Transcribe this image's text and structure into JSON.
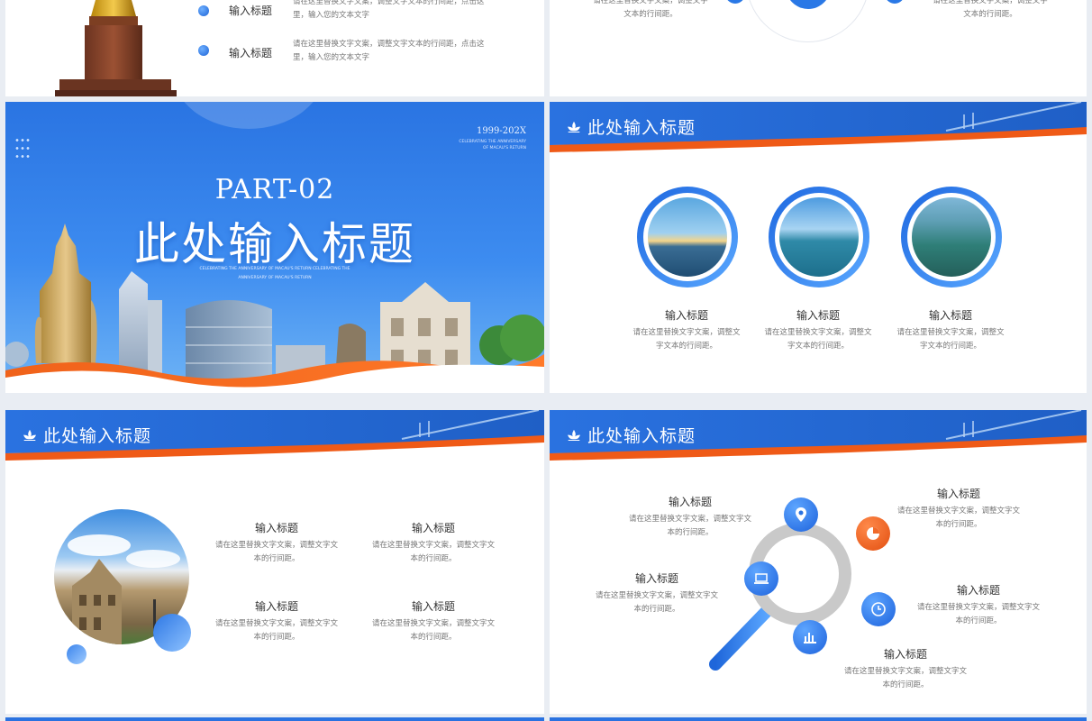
{
  "slide1": {
    "items": [
      {
        "title": "输入标题",
        "text": "请在这里替换文字文案，调整文字文本的行间距，点击这里，输入您的文本文字"
      },
      {
        "title": "输入标题",
        "text": "请在这里替换文字文案，调整文字文本的行间距，点击这里，输入您的文本文字"
      }
    ]
  },
  "slide2": {
    "texts": [
      {
        "text": "请在这里替换文字文案，调整文字文本的行间距。"
      },
      {
        "text": "请在这里替换文字文案，调整文字文本的行间距。"
      }
    ]
  },
  "cover": {
    "years": "1999-202X",
    "years_sub1": "CELEBRATING THE ANNIVERSARY",
    "years_sub2": "OF MACAU'S RETURN",
    "part": "PART-02",
    "title": "此处输入标题",
    "sub1": "CELEBRATING THE ANNIVERSARY OF MACAU'S RETURN CELEBRATING THE",
    "sub2": "ANNIVERSARY OF MACAU'S RETURN"
  },
  "header_title": "此处输入标题",
  "slide4": {
    "items": [
      {
        "title": "输入标题",
        "text": "请在这里替换文字文案，调整文字文本的行间距。"
      },
      {
        "title": "输入标题",
        "text": "请在这里替换文字文案，调整文字文本的行间距。"
      },
      {
        "title": "输入标题",
        "text": "请在这里替换文字文案，调整文字文本的行间距。"
      }
    ]
  },
  "slide5": {
    "items": [
      {
        "title": "输入标题",
        "text": "请在这里替换文字文案，调整文字文本的行间距。"
      },
      {
        "title": "输入标题",
        "text": "请在这里替换文字文案，调整文字文本的行间距。"
      },
      {
        "title": "输入标题",
        "text": "请在这里替换文字文案，调整文字文本的行间距。"
      },
      {
        "title": "输入标题",
        "text": "请在这里替换文字文案，调整文字文本的行间距。"
      }
    ]
  },
  "slide6": {
    "items": [
      {
        "title": "输入标题",
        "text": "请在这里替换文字文案，调整文字文本的行间距。"
      },
      {
        "title": "输入标题",
        "text": "请在这里替换文字文案，调整文字文本的行间距。"
      },
      {
        "title": "输入标题",
        "text": "请在这里替换文字文案，调整文字文本的行间距。"
      },
      {
        "title": "输入标题",
        "text": "请在这里替换文字文案，调整文字文本的行间距。"
      },
      {
        "title": "输入标题",
        "text": "请在这里替换文字文案，调整文字文本的行间距。"
      }
    ],
    "icons": [
      "location-icon",
      "pie-chart-icon",
      "laptop-icon",
      "clock-icon",
      "bar-chart-icon"
    ]
  },
  "colors": {
    "primary_blue": "#1f6fe0",
    "accent_orange": "#ef5a17"
  }
}
